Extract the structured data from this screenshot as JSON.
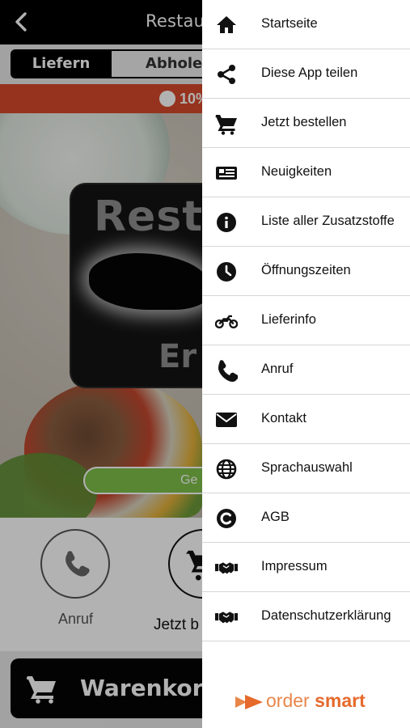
{
  "app": {
    "title": "Restaura",
    "tabs": [
      {
        "label": "Liefern",
        "active": true
      },
      {
        "label": "Abholen",
        "active": false
      }
    ],
    "promo_text": "10%",
    "hero": {
      "logo_word_top": "Resta",
      "logo_word_bottom": "Er",
      "green_button_label": "Ge"
    },
    "actions": {
      "call_label": "Anruf",
      "order_label": "Jetzt b"
    },
    "cart_label": "Warenkorb"
  },
  "drawer": {
    "items": [
      {
        "label": "Startseite",
        "icon": "home-icon"
      },
      {
        "label": "Diese App teilen",
        "icon": "share-icon"
      },
      {
        "label": "Jetzt bestellen",
        "icon": "cart-icon"
      },
      {
        "label": "Neuigkeiten",
        "icon": "newspaper-icon"
      },
      {
        "label": "Liste aller Zusatzstoffe",
        "icon": "info-icon"
      },
      {
        "label": "Öffnungszeiten",
        "icon": "clock-icon"
      },
      {
        "label": "Lieferinfo",
        "icon": "motorcycle-icon"
      },
      {
        "label": "Anruf",
        "icon": "phone-icon"
      },
      {
        "label": "Kontakt",
        "icon": "envelope-icon"
      },
      {
        "label": "Sprachauswahl",
        "icon": "globe-icon"
      },
      {
        "label": "AGB",
        "icon": "copyright-icon"
      },
      {
        "label": "Impressum",
        "icon": "handshake-icon"
      },
      {
        "label": "Datenschutzerklärung",
        "icon": "handshake-icon"
      }
    ],
    "brand": {
      "part1": "order",
      "part2": "smart"
    }
  },
  "colors": {
    "promo": "#d7492b",
    "green": "#7fc04a",
    "brand_orange": "#e66a2c"
  }
}
